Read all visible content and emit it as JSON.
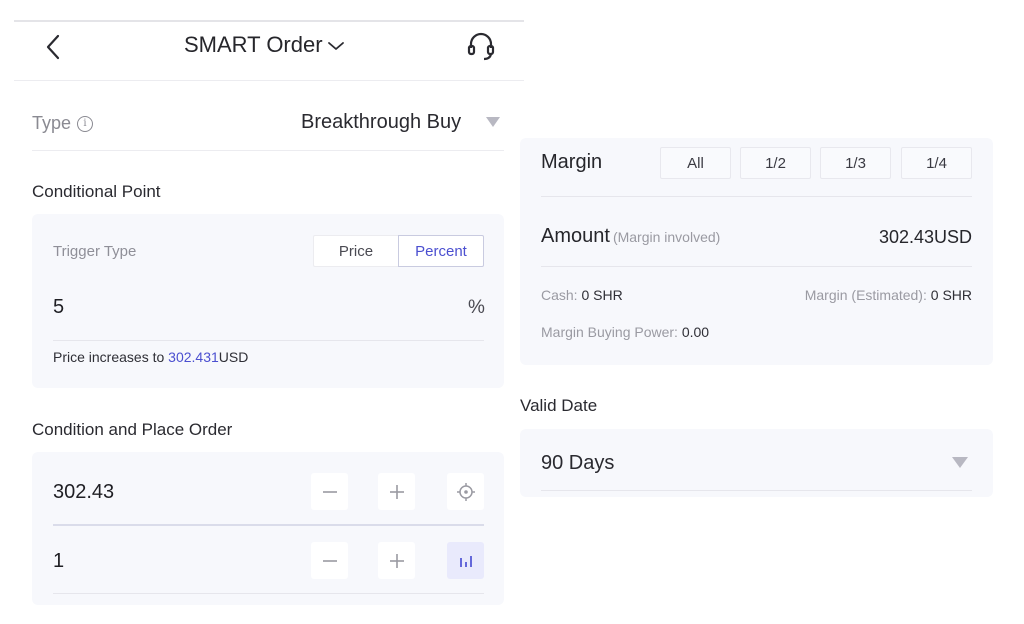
{
  "header": {
    "title": "SMART Order",
    "back_icon": "chevron-left-icon",
    "title_dropdown_icon": "chevron-down-icon",
    "support_icon": "headset-icon"
  },
  "type_row": {
    "label": "Type",
    "info_icon": "i",
    "value": "Breakthrough Buy"
  },
  "conditional_point": {
    "title": "Conditional Point",
    "trigger_type_label": "Trigger Type",
    "trigger_options": [
      "Price",
      "Percent"
    ],
    "selected_trigger": "Percent",
    "value": "5",
    "unit": "%",
    "result_prefix": "Price increases to ",
    "result_price": "302.431",
    "result_currency": "USD"
  },
  "condition_order": {
    "title": "Condition and Place Order",
    "price_value": "302.43",
    "quantity_value": "1",
    "minus_label": "−",
    "plus_label": "+"
  },
  "margin_card": {
    "margin_label": "Margin",
    "ratio_buttons": [
      "All",
      "1/2",
      "1/3",
      "1/4"
    ],
    "amount_label": "Amount",
    "amount_sub": "(Margin involved)",
    "amount_value": "302.43USD",
    "cash_label": "Cash: ",
    "cash_value": "0 SHR",
    "margin_est_label": "Margin (Estimated): ",
    "margin_est_value": "0 SHR",
    "buying_power_label": "Margin Buying Power: ",
    "buying_power_value": "0.00"
  },
  "valid_date": {
    "label": "Valid Date",
    "value": "90 Days"
  },
  "colors": {
    "accent": "#4b4fd0",
    "card_bg": "#f7f8fc",
    "active_btn_bg": "#e9eafc"
  }
}
